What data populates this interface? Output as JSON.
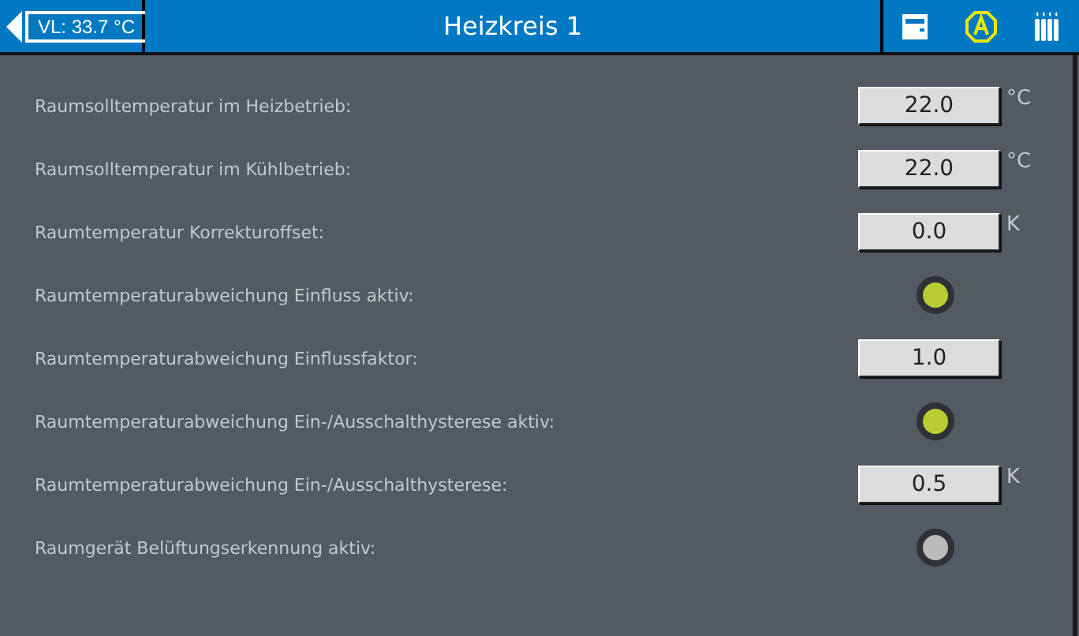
{
  "header": {
    "flow_temp": "VL: 33.7 °C",
    "title": "Heizkreis 1"
  },
  "rows": [
    {
      "kind": "value",
      "label": "Raumsolltemperatur im Heizbetrieb:",
      "value": "22.0",
      "unit": "°C"
    },
    {
      "kind": "value",
      "label": "Raumsolltemperatur im Kühlbetrieb:",
      "value": "22.0",
      "unit": "°C"
    },
    {
      "kind": "value",
      "label": "Raumtemperatur Korrekturoffset:",
      "value": "0.0",
      "unit": "K"
    },
    {
      "kind": "switch",
      "label": "Raumtemperaturabweichung Einfluss aktiv:",
      "on": true
    },
    {
      "kind": "value",
      "label": "Raumtemperaturabweichung Einflussfaktor:",
      "value": "1.0"
    },
    {
      "kind": "switch",
      "label": "Raumtemperaturabweichung Ein-/Ausschalthysterese aktiv:",
      "on": true
    },
    {
      "kind": "value",
      "label": "Raumtemperaturabweichung Ein-/Ausschalthysterese:",
      "value": "0.5",
      "unit": "K"
    },
    {
      "kind": "switch",
      "label": "Raumgerät Belüftungserkennung aktiv:",
      "on": false
    }
  ]
}
